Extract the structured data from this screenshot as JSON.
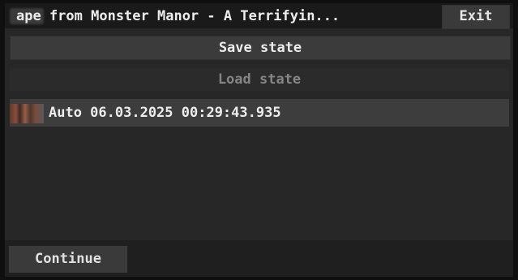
{
  "window": {
    "title": "ape from Monster Manor - A Terrifyin...",
    "exit_label": "Exit"
  },
  "menu": {
    "save_label": "Save state",
    "load_label": "Load state"
  },
  "save_slots": [
    {
      "label": "Auto 06.03.2025 00:29:43.935"
    }
  ],
  "footer": {
    "continue_label": "Continue"
  }
}
